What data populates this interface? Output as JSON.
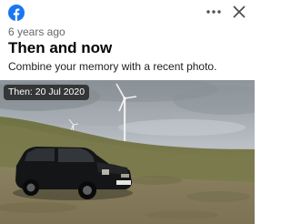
{
  "header": {
    "time_ago": "6 years ago",
    "title": "Then and now",
    "subtitle": "Combine your memory with a recent photo."
  },
  "photo": {
    "badge": "Then: 20 Jul 2020",
    "plate": "E 1005"
  },
  "colors": {
    "facebook_blue": "#1877f2",
    "text_primary": "#050505",
    "text_secondary": "#65676b"
  },
  "icons": {
    "logo": "facebook-logo-icon",
    "more": "more-options-icon",
    "close": "close-icon"
  }
}
